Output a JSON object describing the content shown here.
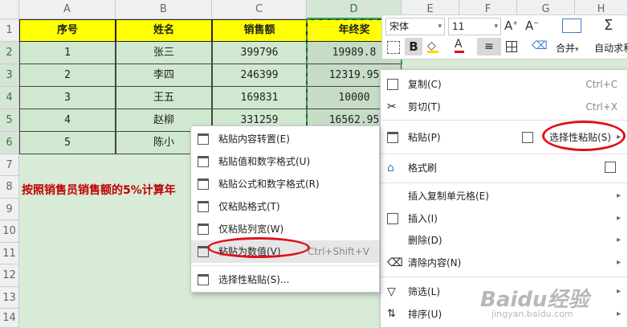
{
  "columns": [
    "A",
    "B",
    "C",
    "D",
    "E",
    "F",
    "G",
    "H"
  ],
  "rows": [
    "1",
    "2",
    "3",
    "4",
    "5",
    "6",
    "7",
    "8",
    "9",
    "10",
    "11",
    "12",
    "13",
    "14"
  ],
  "table": {
    "headers": [
      "序号",
      "姓名",
      "销售额",
      "年终奖"
    ],
    "data": [
      [
        "1",
        "张三",
        "399796",
        "19989.8"
      ],
      [
        "2",
        "李四",
        "246399",
        "12319.95"
      ],
      [
        "3",
        "王五",
        "169831",
        "10000"
      ],
      [
        "4",
        "赵柳",
        "331259",
        "16562.95"
      ],
      [
        "5",
        "陈小",
        "",
        ""
      ]
    ]
  },
  "note": "按照销售员销售额的5%计算年",
  "toolbar": {
    "font_name": "宋体",
    "font_size": "11",
    "bold": "B",
    "merge_label": "合并",
    "autosum_label": "自动求和"
  },
  "context_menu": {
    "items": [
      {
        "label": "复制(C)",
        "shortcut": "Ctrl+C"
      },
      {
        "label": "剪切(T)",
        "shortcut": "Ctrl+X"
      },
      {
        "label": "粘贴(P)"
      },
      {
        "label": "选择性粘贴(S)"
      },
      {
        "label": "格式刷"
      },
      {
        "label": "插入复制单元格(E)"
      },
      {
        "label": "插入(I)"
      },
      {
        "label": "删除(D)"
      },
      {
        "label": "清除内容(N)"
      },
      {
        "label": "筛选(L)"
      },
      {
        "label": "排序(U)"
      }
    ]
  },
  "submenu": {
    "items": [
      {
        "label": "粘贴内容转置(E)"
      },
      {
        "label": "粘贴值和数字格式(U)"
      },
      {
        "label": "粘贴公式和数字格式(R)"
      },
      {
        "label": "仅粘贴格式(T)"
      },
      {
        "label": "仅粘贴列宽(W)"
      },
      {
        "label": "粘贴为数值(V)",
        "shortcut": "Ctrl+Shift+V"
      },
      {
        "label": "选择性粘贴(S)..."
      }
    ]
  },
  "watermark": {
    "brand": "Baidu经验",
    "url": "jingyan.baidu.com"
  },
  "colors": {
    "header_fill": "#ffff00",
    "body_fill": "#d0e8d0",
    "note": "#c00000",
    "annotation": "#e0101a",
    "selection": "#3a9a48"
  }
}
